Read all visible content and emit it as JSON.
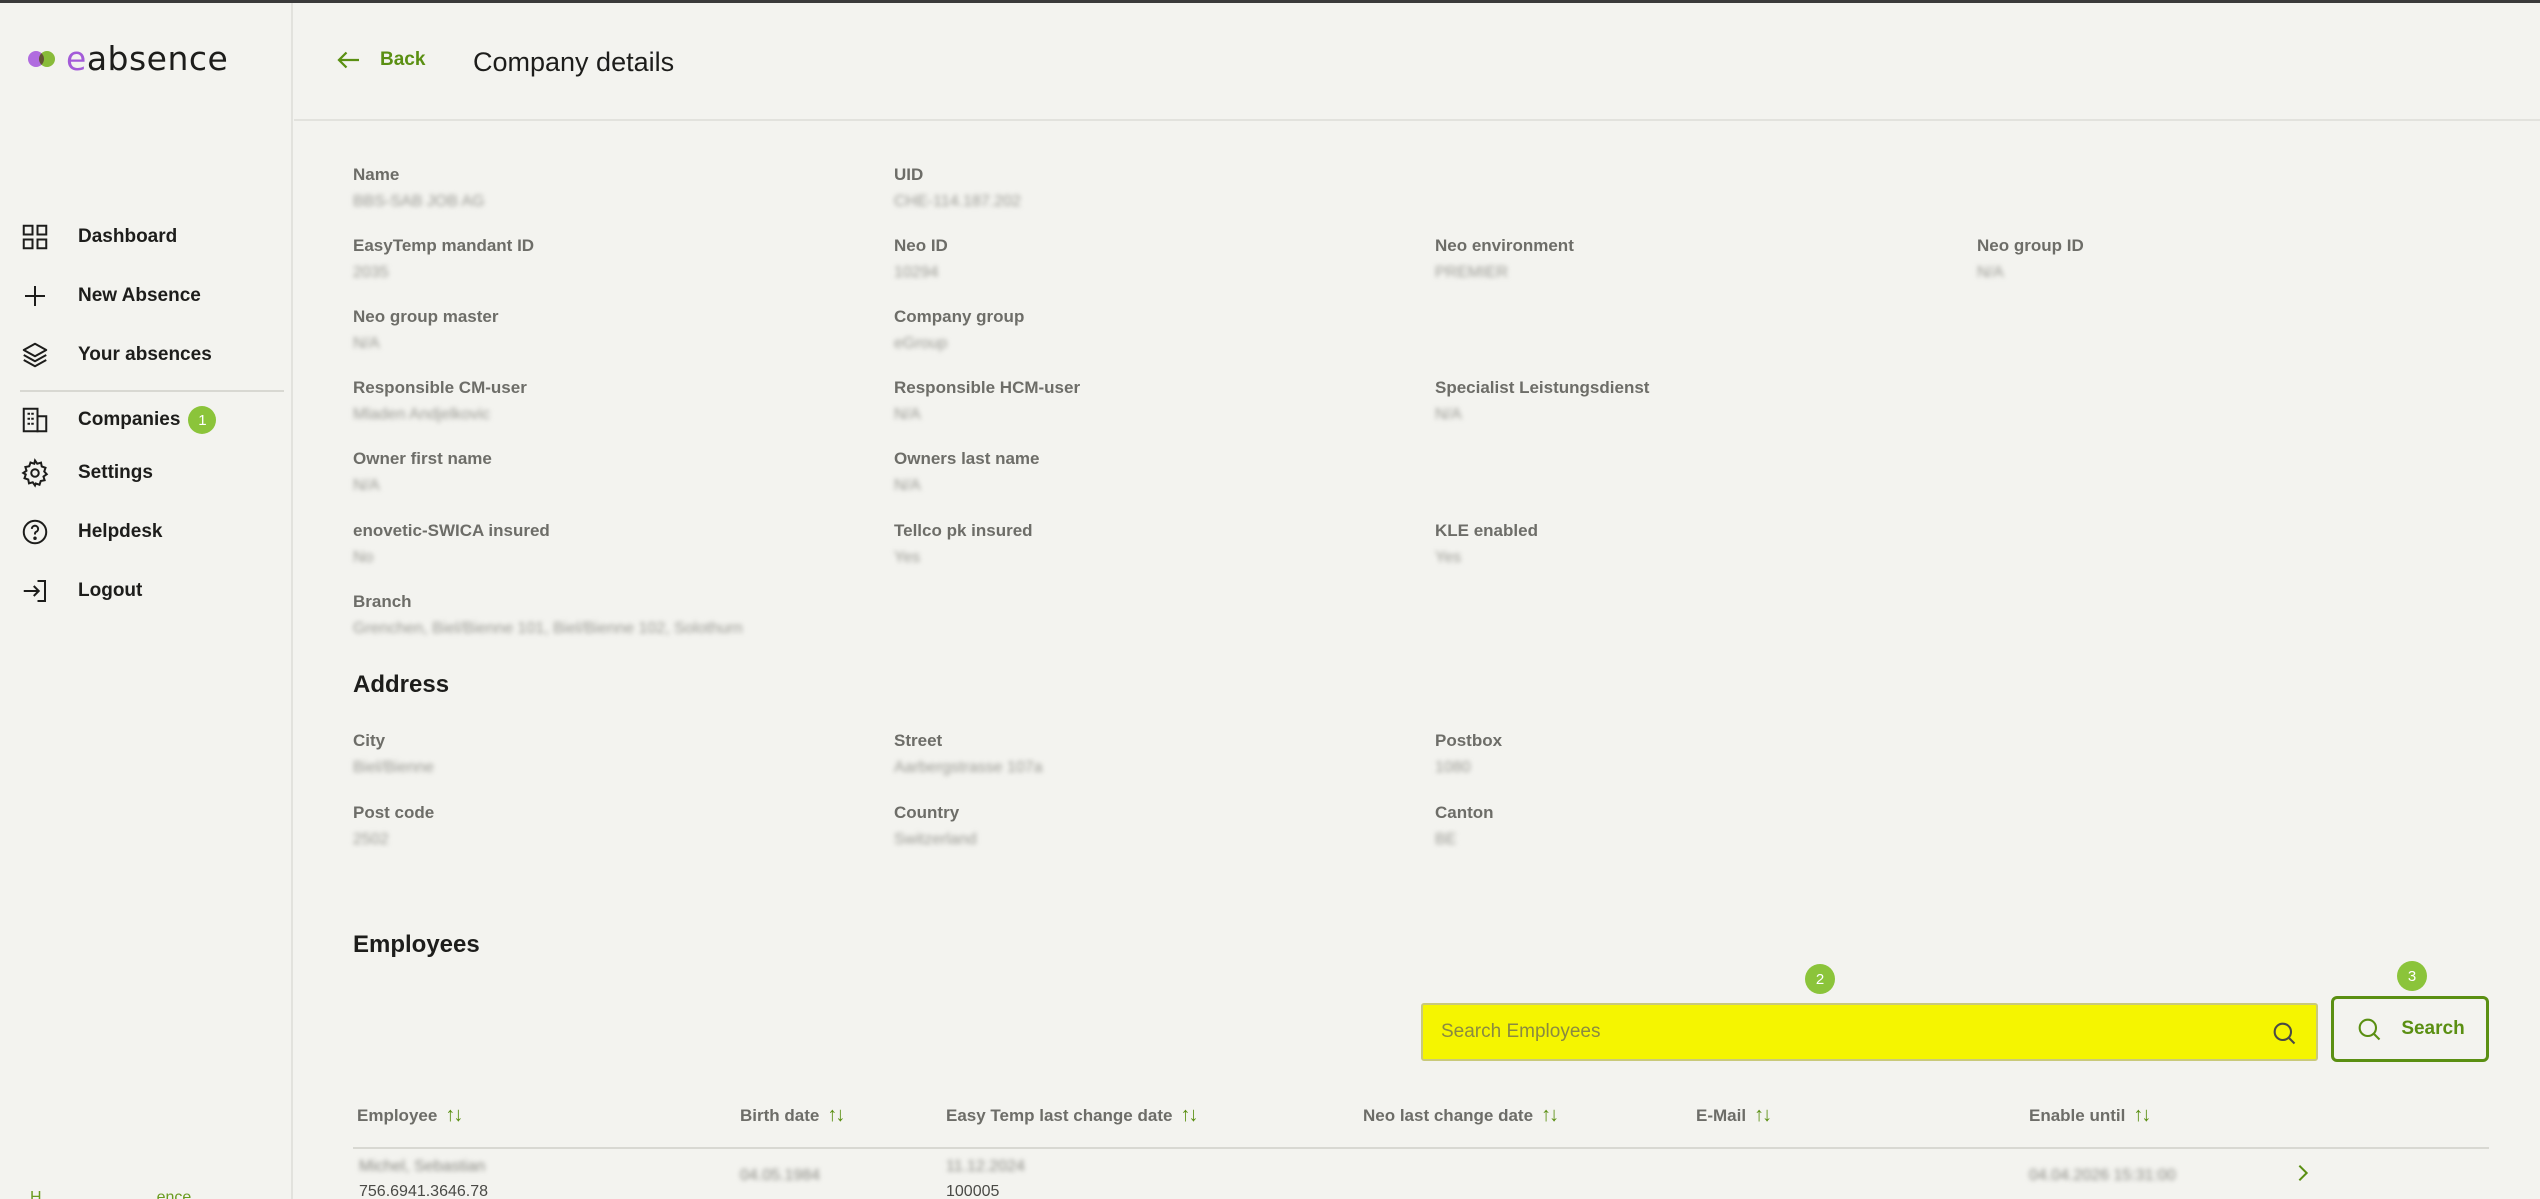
{
  "app": {
    "logo_prefix": "e",
    "logo_rest": "absence",
    "brand_green": "#8bc43a",
    "brand_purple": "#a35bd8",
    "highlight": "#f5f500"
  },
  "sidebar": {
    "items": [
      {
        "label": "Dashboard",
        "icon": "dashboard-icon"
      },
      {
        "label": "New Absence",
        "icon": "plus-icon"
      },
      {
        "label": "Your absences",
        "icon": "layers-icon"
      },
      {
        "label": "Companies",
        "icon": "building-icon",
        "badge": "1"
      },
      {
        "label": "Settings",
        "icon": "gear-icon"
      },
      {
        "label": "Helpdesk",
        "icon": "help-icon"
      },
      {
        "label": "Logout",
        "icon": "logout-icon"
      }
    ],
    "footer_left": "H",
    "footer_right": "ence"
  },
  "header": {
    "back_label": "Back",
    "title": "Company details"
  },
  "details": {
    "name": {
      "label": "Name",
      "value": "BBS-SAB JOB AG"
    },
    "uid": {
      "label": "UID",
      "value": "CHE-114.187.202"
    },
    "easytemp_mandant_id": {
      "label": "EasyTemp mandant ID",
      "value": "2035"
    },
    "neo_id": {
      "label": "Neo ID",
      "value": "10294"
    },
    "neo_environment": {
      "label": "Neo environment",
      "value": "PREMIER"
    },
    "neo_group_id": {
      "label": "Neo group ID",
      "value": "N/A"
    },
    "neo_group_master": {
      "label": "Neo group master",
      "value": "N/A"
    },
    "company_group": {
      "label": "Company group",
      "value": "eGroup"
    },
    "responsible_cm_user": {
      "label": "Responsible CM-user",
      "value": "Mladen Andjelkovic"
    },
    "responsible_hcm_user": {
      "label": "Responsible HCM-user",
      "value": "N/A"
    },
    "specialist_leistungsdienst": {
      "label": "Specialist Leistungsdienst",
      "value": "N/A"
    },
    "owner_first_name": {
      "label": "Owner first name",
      "value": "N/A"
    },
    "owners_last_name": {
      "label": "Owners last name",
      "value": "N/A"
    },
    "enovetic_swica_insured": {
      "label": "enovetic-SWICA insured",
      "value": "No"
    },
    "tellco_pk_insured": {
      "label": "Tellco pk insured",
      "value": "Yes"
    },
    "kle_enabled": {
      "label": "KLE enabled",
      "value": "Yes"
    },
    "branch": {
      "label": "Branch",
      "value": "Grenchen, Biel/Bienne 101, Biel/Bienne 102, Solothurn"
    }
  },
  "address": {
    "title": "Address",
    "city": {
      "label": "City",
      "value": "Biel/Bienne"
    },
    "street": {
      "label": "Street",
      "value": "Aarbergstrasse 107a"
    },
    "postbox": {
      "label": "Postbox",
      "value": "1080"
    },
    "post_code": {
      "label": "Post code",
      "value": "2502"
    },
    "country": {
      "label": "Country",
      "value": "Switzerland"
    },
    "canton": {
      "label": "Canton",
      "value": "BE"
    }
  },
  "employees": {
    "title": "Employees",
    "search_placeholder": "Search Employees",
    "search_button": "Search",
    "marks": [
      "2",
      "3"
    ],
    "columns": [
      {
        "label": "Employee",
        "sort": "↑↓"
      },
      {
        "label": "Birth date",
        "sort": "↑↓"
      },
      {
        "label": "Easy Temp last change date",
        "sort": "↑↓"
      },
      {
        "label": "Neo last change date",
        "sort": "↑↓"
      },
      {
        "label": "E-Mail",
        "sort": "↑↓"
      },
      {
        "label": "Enable until",
        "sort": "↑↓"
      }
    ],
    "rows": [
      {
        "employee_name": "Michel, Sebastian",
        "employee_ahv": "756.6941.3646.78",
        "birth_date": "04.05.1984",
        "easytemp_date": "11.12.2024",
        "easytemp_id": "100005",
        "neo_date": "",
        "email": "",
        "enable_until": "04.04.2026 15:31:00"
      }
    ]
  }
}
